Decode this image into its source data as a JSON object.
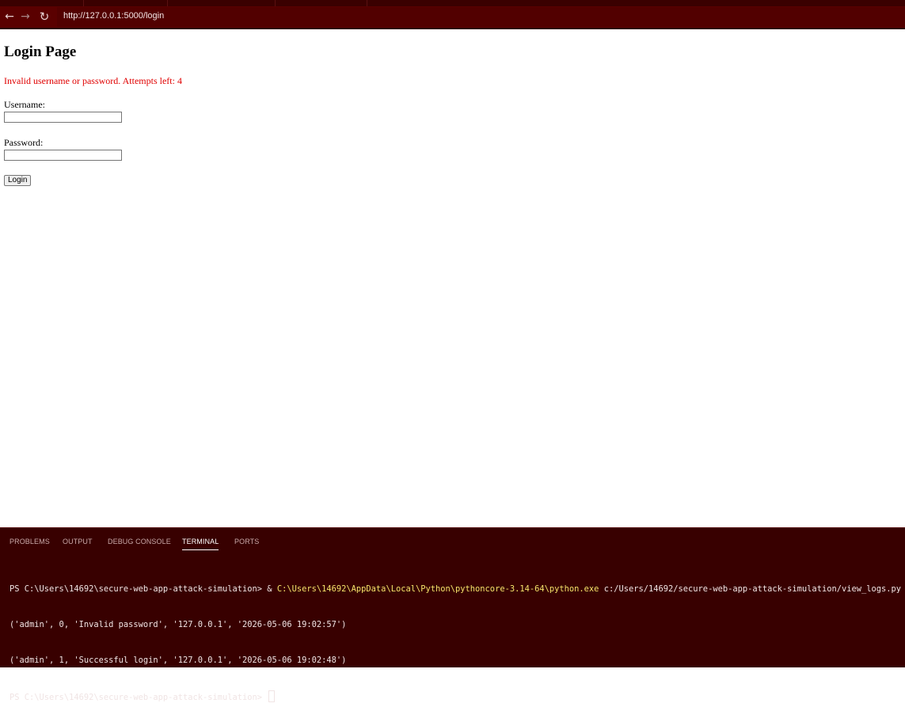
{
  "browser": {
    "url": "http://127.0.0.1:5000/login",
    "icons": {
      "back": "arrow-left-icon",
      "forward": "arrow-right-icon",
      "reload": "reload-icon"
    }
  },
  "page": {
    "title": "Login Page",
    "error": "Invalid username or password. Attempts left: 4",
    "username_label": "Username:",
    "username_value": "",
    "password_label": "Password:",
    "password_value": "",
    "login_button": "Login"
  },
  "panel": {
    "tabs": [
      {
        "label": "PROBLEMS",
        "active": false
      },
      {
        "label": "OUTPUT",
        "active": false
      },
      {
        "label": "DEBUG CONSOLE",
        "active": false
      },
      {
        "label": "TERMINAL",
        "active": true
      },
      {
        "label": "PORTS",
        "active": false
      }
    ],
    "terminal": {
      "prompt1": "PS C:\\Users\\14692\\secure-web-app-attack-simulation> ",
      "amp": "& ",
      "exe": "C:\\Users\\14692\\AppData\\Local\\Python\\pythoncore-3.14-64\\python.exe",
      "script": " c:/Users/14692/secure-web-app-attack-simulation/view_logs.py",
      "out1": "('admin', 0, 'Invalid password', '127.0.0.1', '2026-05-06 19:02:57')",
      "out2": "('admin', 1, 'Successful login', '127.0.0.1', '2026-05-06 19:02:48')",
      "prompt2": "PS C:\\Users\\14692\\secure-web-app-attack-simulation> "
    }
  },
  "colors": {
    "error": "#e00000",
    "chrome": "#5a0000",
    "panel_bg": "#380000",
    "terminal_highlight": "#f5e36a"
  }
}
